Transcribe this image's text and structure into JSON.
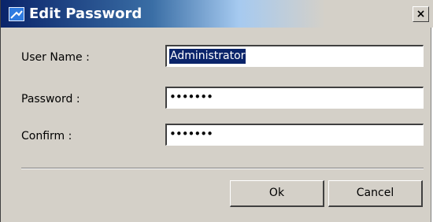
{
  "window": {
    "title": "Edit Password",
    "close_glyph": "×",
    "icon": "app-icon"
  },
  "form": {
    "username_label": "User Name :",
    "username_value": "Administrator",
    "password_label": "Password :",
    "password_value": "•••••••",
    "confirm_label": "Confirm :",
    "confirm_value": "•••••••"
  },
  "buttons": {
    "ok_label": "Ok",
    "cancel_label": "Cancel"
  },
  "colors": {
    "titlebar_start": "#0a246a",
    "selection": "#0a246a",
    "face": "#d4d0c8"
  }
}
